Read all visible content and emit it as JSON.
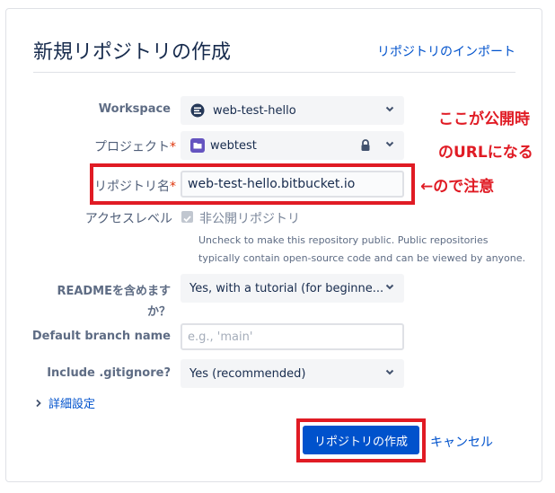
{
  "header": {
    "title": "新規リポジトリの作成",
    "import_link": "リポジトリのインポート"
  },
  "form": {
    "workspace": {
      "label": "Workspace",
      "value": "web-test-hello"
    },
    "project": {
      "label": "プロジェクト",
      "required_mark": "*",
      "value": "webtest"
    },
    "repo_name": {
      "label": "リポジトリ名",
      "required_mark": "*",
      "value": "web-test-hello.bitbucket.io"
    },
    "access_level": {
      "label": "アクセスレベル",
      "checkbox_label": "非公開リポジトリ",
      "checked": true,
      "help_line1": "Uncheck to make this repository public. Public repositories",
      "help_line2": "typically contain open-source code and can be viewed by anyone."
    },
    "readme": {
      "label_line1": "READMEを含めます",
      "label_line2": "か？",
      "value": "Yes, with a tutorial (for beginne..."
    },
    "default_branch": {
      "label": "Default branch name",
      "placeholder": "e.g., 'main'"
    },
    "gitignore": {
      "label": "Include .gitignore?",
      "value": "Yes (recommended)"
    },
    "advanced": {
      "label": "詳細設定"
    }
  },
  "actions": {
    "create_label": "リポジトリの作成",
    "cancel_label": "キャンセル"
  },
  "annotations": {
    "line1": "ここが公開時",
    "line2": "のURLになる",
    "line3": "←ので注意"
  },
  "colors": {
    "accent": "#0052cc",
    "annotation_red": "#e01b24",
    "project_icon": "#6554c0",
    "workspace_icon": "#253858"
  }
}
